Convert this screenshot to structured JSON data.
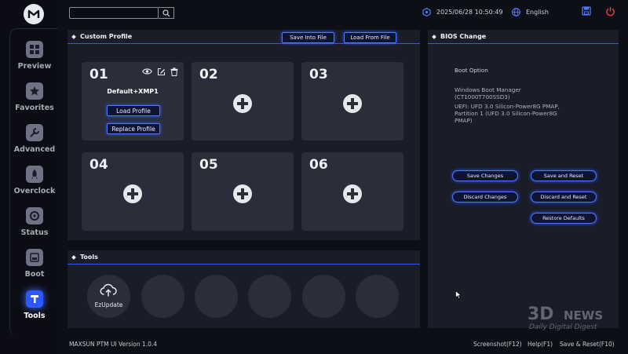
{
  "app": {
    "logo_icon": "maxsun-logo-icon",
    "version": "MAXSUN PTM UI Version 1.0.4"
  },
  "search": {
    "placeholder": ""
  },
  "topbar": {
    "datetime": "2025/06/28 10:50:49",
    "language": "English"
  },
  "sidebar": {
    "items": [
      {
        "label": "Preview",
        "icon": "grid-icon"
      },
      {
        "label": "Favorites",
        "icon": "star-icon"
      },
      {
        "label": "Advanced",
        "icon": "wrench-icon"
      },
      {
        "label": "Overclock",
        "icon": "rocket-icon"
      },
      {
        "label": "Status",
        "icon": "gauge-icon"
      },
      {
        "label": "Boot",
        "icon": "ssd-icon"
      },
      {
        "label": "Tools",
        "icon": "tools-icon",
        "active": true
      }
    ]
  },
  "custom_profile": {
    "title": "Custom Profile",
    "save_file": "Save Into File",
    "load_file": "Load From File",
    "slots": [
      {
        "num": "01",
        "name": "Default+XMP1",
        "load": "Load Profile",
        "replace": "Replace Profile"
      },
      {
        "num": "02"
      },
      {
        "num": "03"
      },
      {
        "num": "04"
      },
      {
        "num": "05"
      },
      {
        "num": "06"
      }
    ]
  },
  "tools": {
    "title": "Tools",
    "ezupdate": "EzUpdate"
  },
  "bios_change": {
    "title": "BIOS Change",
    "boot_option": "Boot Option",
    "entries": [
      "Windows Boot Manager (CT1000T700SSD3)",
      "UEFI: UFD 3.0 Silicon-Power8G PMAP, Partition 1 (UFD 3.0 Silicon-Power8G PMAP)"
    ],
    "save_changes": "Save Changes",
    "save_reset": "Save and Reset",
    "discard_changes": "Discard Changes",
    "discard_reset": "Discard and Reset",
    "restore_defaults": "Restore Defaults"
  },
  "footer": {
    "screenshot": "Screenshot(F12)",
    "help": "Help(F1)",
    "save_reset": "Save & Reset(F10)"
  },
  "watermark": {
    "brand": "3DNEWS",
    "tagline": "Daily Digital Digest"
  },
  "colors": {
    "accent": "#2f57ff",
    "power": "#e03a3a",
    "panel": "#1a1c27",
    "slot": "#2b2e3a"
  }
}
